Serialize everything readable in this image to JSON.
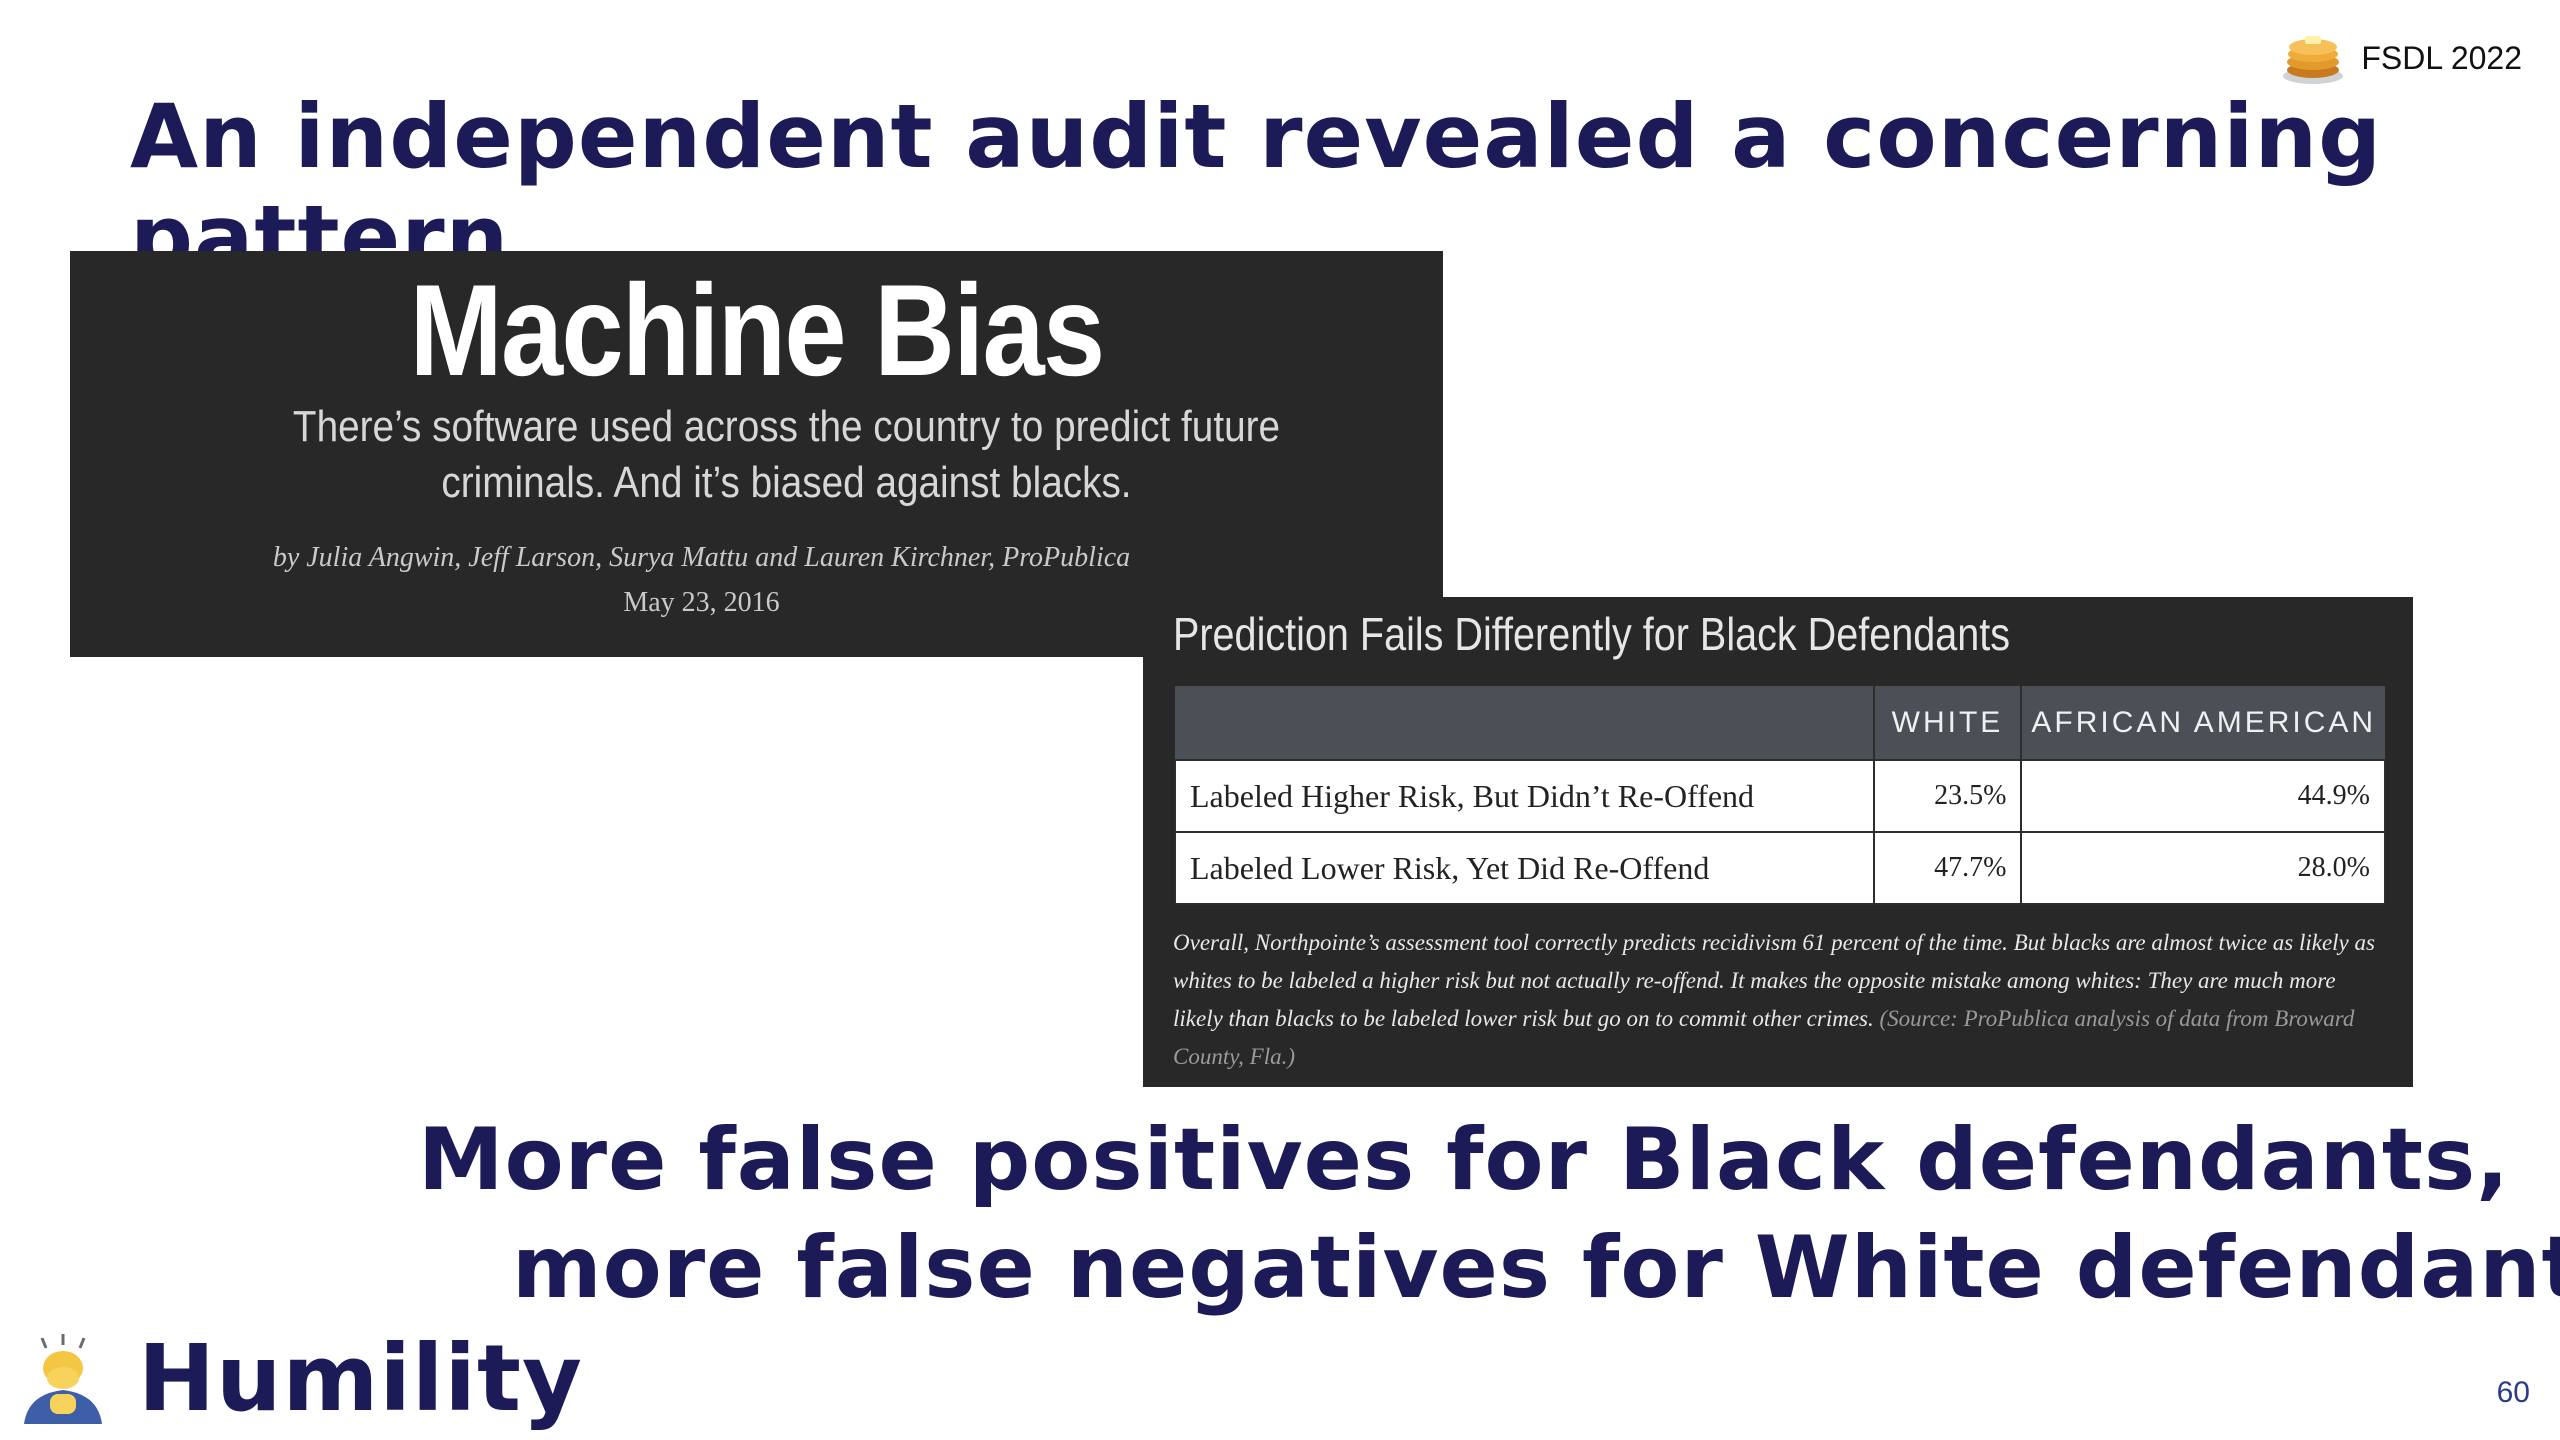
{
  "header": {
    "brand_label": "FSDL 2022",
    "brand_icon": "pancakes-icon"
  },
  "slide": {
    "title": "An independent audit revealed a concerning pattern.",
    "conclusion_line1": "More false positives for Black defendants,",
    "conclusion_line2": "more false negatives for White defendants."
  },
  "article": {
    "headline": "Machine Bias",
    "dek": "There’s software used across the country to predict future criminals. And it’s biased against blacks.",
    "byline": "by Julia Angwin, Jeff Larson, Surya Mattu and Lauren Kirchner, ProPublica",
    "date": "May 23, 2016"
  },
  "table": {
    "caption": "Prediction Fails Differently for Black Defendants",
    "columns": [
      "",
      "WHITE",
      "AFRICAN AMERICAN"
    ],
    "rows": [
      {
        "label": "Labeled Higher Risk, But Didn’t Re-Offend",
        "white": "23.5%",
        "african_american": "44.9%"
      },
      {
        "label": "Labeled Lower Risk, Yet Did Re-Offend",
        "white": "47.7%",
        "african_american": "28.0%"
      }
    ],
    "note": "Overall, Northpointe’s assessment tool correctly predicts recidivism 61 percent of the time. But blacks are almost twice as likely as whites to be labeled a higher risk but not actually re-offend. It makes the opposite mistake among whites: They are much more likely than blacks to be labeled lower risk but go on to commit other crimes.",
    "source": "(Source: ProPublica analysis of data from Broward County, Fla.)"
  },
  "footer": {
    "section_label": "Humility",
    "section_icon": "person-bowing-icon",
    "page_number": "60"
  },
  "colors": {
    "navy_text": "#1c1a57",
    "card_bg": "#282828",
    "table_header_bg": "#4b4f56",
    "page_number": "#2c3a8c"
  }
}
